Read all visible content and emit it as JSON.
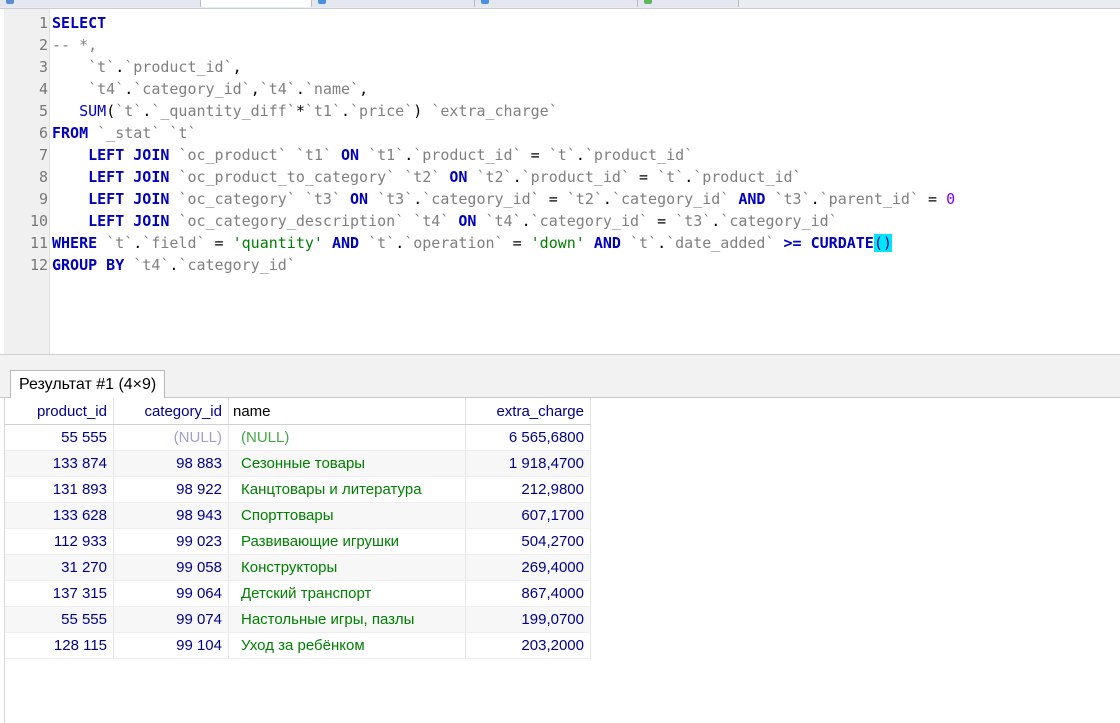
{
  "editor": {
    "lines": [
      {
        "n": "1",
        "tokens": [
          {
            "c": "kw",
            "t": "SELECT"
          }
        ]
      },
      {
        "n": "2",
        "tokens": [
          {
            "c": "cm",
            "t": "-- *,"
          }
        ]
      },
      {
        "n": "3",
        "tokens": [
          {
            "c": "pn",
            "t": "    "
          },
          {
            "c": "id",
            "t": "`t`"
          },
          {
            "c": "pn",
            "t": "."
          },
          {
            "c": "id",
            "t": "`product_id`"
          },
          {
            "c": "pn",
            "t": ","
          }
        ]
      },
      {
        "n": "4",
        "tokens": [
          {
            "c": "pn",
            "t": "    "
          },
          {
            "c": "id",
            "t": "`t4`"
          },
          {
            "c": "pn",
            "t": "."
          },
          {
            "c": "id",
            "t": "`category_id`"
          },
          {
            "c": "pn",
            "t": ","
          },
          {
            "c": "id",
            "t": "`t4`"
          },
          {
            "c": "pn",
            "t": "."
          },
          {
            "c": "id",
            "t": "`name`"
          },
          {
            "c": "pn",
            "t": ","
          }
        ]
      },
      {
        "n": "5",
        "tokens": [
          {
            "c": "pn",
            "t": "   "
          },
          {
            "c": "fn",
            "t": "SUM"
          },
          {
            "c": "pn",
            "t": "("
          },
          {
            "c": "id",
            "t": "`t`"
          },
          {
            "c": "pn",
            "t": "."
          },
          {
            "c": "id",
            "t": "`_quantity_diff`"
          },
          {
            "c": "pn",
            "t": "*"
          },
          {
            "c": "id",
            "t": "`t1`"
          },
          {
            "c": "pn",
            "t": "."
          },
          {
            "c": "id",
            "t": "`price`"
          },
          {
            "c": "pn",
            "t": ") "
          },
          {
            "c": "id",
            "t": "`extra_charge`"
          }
        ]
      },
      {
        "n": "6",
        "tokens": [
          {
            "c": "kw",
            "t": "FROM"
          },
          {
            "c": "pn",
            "t": " "
          },
          {
            "c": "id",
            "t": "`_stat`"
          },
          {
            "c": "pn",
            "t": " "
          },
          {
            "c": "id",
            "t": "`t`"
          }
        ]
      },
      {
        "n": "7",
        "tokens": [
          {
            "c": "pn",
            "t": "    "
          },
          {
            "c": "kw",
            "t": "LEFT JOIN"
          },
          {
            "c": "pn",
            "t": " "
          },
          {
            "c": "id",
            "t": "`oc_product`"
          },
          {
            "c": "pn",
            "t": " "
          },
          {
            "c": "id",
            "t": "`t1`"
          },
          {
            "c": "pn",
            "t": " "
          },
          {
            "c": "kw",
            "t": "ON"
          },
          {
            "c": "pn",
            "t": " "
          },
          {
            "c": "id",
            "t": "`t1`"
          },
          {
            "c": "pn",
            "t": "."
          },
          {
            "c": "id",
            "t": "`product_id`"
          },
          {
            "c": "pn",
            "t": " = "
          },
          {
            "c": "id",
            "t": "`t`"
          },
          {
            "c": "pn",
            "t": "."
          },
          {
            "c": "id",
            "t": "`product_id`"
          }
        ]
      },
      {
        "n": "8",
        "tokens": [
          {
            "c": "pn",
            "t": "    "
          },
          {
            "c": "kw",
            "t": "LEFT JOIN"
          },
          {
            "c": "pn",
            "t": " "
          },
          {
            "c": "id",
            "t": "`oc_product_to_category`"
          },
          {
            "c": "pn",
            "t": " "
          },
          {
            "c": "id",
            "t": "`t2`"
          },
          {
            "c": "pn",
            "t": " "
          },
          {
            "c": "kw",
            "t": "ON"
          },
          {
            "c": "pn",
            "t": " "
          },
          {
            "c": "id",
            "t": "`t2`"
          },
          {
            "c": "pn",
            "t": "."
          },
          {
            "c": "id",
            "t": "`product_id`"
          },
          {
            "c": "pn",
            "t": " = "
          },
          {
            "c": "id",
            "t": "`t`"
          },
          {
            "c": "pn",
            "t": "."
          },
          {
            "c": "id",
            "t": "`product_id`"
          }
        ]
      },
      {
        "n": "9",
        "tokens": [
          {
            "c": "pn",
            "t": "    "
          },
          {
            "c": "kw",
            "t": "LEFT JOIN"
          },
          {
            "c": "pn",
            "t": " "
          },
          {
            "c": "id",
            "t": "`oc_category`"
          },
          {
            "c": "pn",
            "t": " "
          },
          {
            "c": "id",
            "t": "`t3`"
          },
          {
            "c": "pn",
            "t": " "
          },
          {
            "c": "kw",
            "t": "ON"
          },
          {
            "c": "pn",
            "t": " "
          },
          {
            "c": "id",
            "t": "`t3`"
          },
          {
            "c": "pn",
            "t": "."
          },
          {
            "c": "id",
            "t": "`category_id`"
          },
          {
            "c": "pn",
            "t": " = "
          },
          {
            "c": "id",
            "t": "`t2`"
          },
          {
            "c": "pn",
            "t": "."
          },
          {
            "c": "id",
            "t": "`category_id`"
          },
          {
            "c": "pn",
            "t": " "
          },
          {
            "c": "kw",
            "t": "AND"
          },
          {
            "c": "pn",
            "t": " "
          },
          {
            "c": "id",
            "t": "`t3`"
          },
          {
            "c": "pn",
            "t": "."
          },
          {
            "c": "id",
            "t": "`parent_id`"
          },
          {
            "c": "pn",
            "t": " = "
          },
          {
            "c": "num",
            "t": "0"
          }
        ]
      },
      {
        "n": "10",
        "tokens": [
          {
            "c": "pn",
            "t": "    "
          },
          {
            "c": "kw",
            "t": "LEFT JOIN"
          },
          {
            "c": "pn",
            "t": " "
          },
          {
            "c": "id",
            "t": "`oc_category_description`"
          },
          {
            "c": "pn",
            "t": " "
          },
          {
            "c": "id",
            "t": "`t4`"
          },
          {
            "c": "pn",
            "t": " "
          },
          {
            "c": "kw",
            "t": "ON"
          },
          {
            "c": "pn",
            "t": " "
          },
          {
            "c": "id",
            "t": "`t4`"
          },
          {
            "c": "pn",
            "t": "."
          },
          {
            "c": "id",
            "t": "`category_id`"
          },
          {
            "c": "pn",
            "t": " = "
          },
          {
            "c": "id",
            "t": "`t3`"
          },
          {
            "c": "pn",
            "t": "."
          },
          {
            "c": "id",
            "t": "`category_id`"
          }
        ]
      },
      {
        "n": "11",
        "tokens": [
          {
            "c": "kw",
            "t": "WHERE"
          },
          {
            "c": "pn",
            "t": " "
          },
          {
            "c": "id",
            "t": "`t`"
          },
          {
            "c": "pn",
            "t": "."
          },
          {
            "c": "id",
            "t": "`field`"
          },
          {
            "c": "pn",
            "t": " = "
          },
          {
            "c": "st",
            "t": "'quantity'"
          },
          {
            "c": "pn",
            "t": " "
          },
          {
            "c": "kw",
            "t": "AND"
          },
          {
            "c": "pn",
            "t": " "
          },
          {
            "c": "id",
            "t": "`t`"
          },
          {
            "c": "pn",
            "t": "."
          },
          {
            "c": "id",
            "t": "`operation`"
          },
          {
            "c": "pn",
            "t": " = "
          },
          {
            "c": "st",
            "t": "'down'"
          },
          {
            "c": "pn",
            "t": " "
          },
          {
            "c": "kw",
            "t": "AND"
          },
          {
            "c": "pn",
            "t": " "
          },
          {
            "c": "id",
            "t": "`t`"
          },
          {
            "c": "pn",
            "t": "."
          },
          {
            "c": "id",
            "t": "`date_added`"
          },
          {
            "c": "pn",
            "t": " "
          },
          {
            "c": "kw",
            "t": ">="
          },
          {
            "c": "pn",
            "t": " "
          },
          {
            "c": "kw",
            "t": "CURDATE"
          },
          {
            "c": "hl",
            "t": "()"
          }
        ]
      },
      {
        "n": "12",
        "tokens": [
          {
            "c": "kw",
            "t": "GROUP BY"
          },
          {
            "c": "pn",
            "t": " "
          },
          {
            "c": "id",
            "t": "`t4`"
          },
          {
            "c": "pn",
            "t": "."
          },
          {
            "c": "id",
            "t": "`category_id`"
          }
        ]
      }
    ]
  },
  "result": {
    "tab_label": "Результат #1 (4×9)",
    "columns": [
      "product_id",
      "category_id",
      "name",
      "extra_charge"
    ],
    "rows": [
      [
        "55 555",
        "(NULL)",
        "(NULL)",
        "6 565,6800"
      ],
      [
        "133 874",
        "98 883",
        "Сезонные товары",
        "1 918,4700"
      ],
      [
        "131 893",
        "98 922",
        "Канцтовары и литература",
        "212,9800"
      ],
      [
        "133 628",
        "98 943",
        "Спорттовары",
        "607,1700"
      ],
      [
        "112 933",
        "99 023",
        "Развивающие игрушки",
        "504,2700"
      ],
      [
        "31 270",
        "99 058",
        "Конструкторы",
        "269,4000"
      ],
      [
        "137 315",
        "99 064",
        "Детский транспорт",
        "867,4000"
      ],
      [
        "55 555",
        "99 074",
        "Настольные игры, пазлы",
        "199,0700"
      ],
      [
        "128 115",
        "99 104",
        "Уход за ребёнком",
        "203,2000"
      ]
    ]
  },
  "colors": {
    "keyword": "#0000c0",
    "identifier": "#808080",
    "string": "#008000",
    "number": "#8000ff",
    "bracket_highlight": "#00e5ff",
    "cell_number": "#00008b",
    "cell_text": "#008000"
  }
}
